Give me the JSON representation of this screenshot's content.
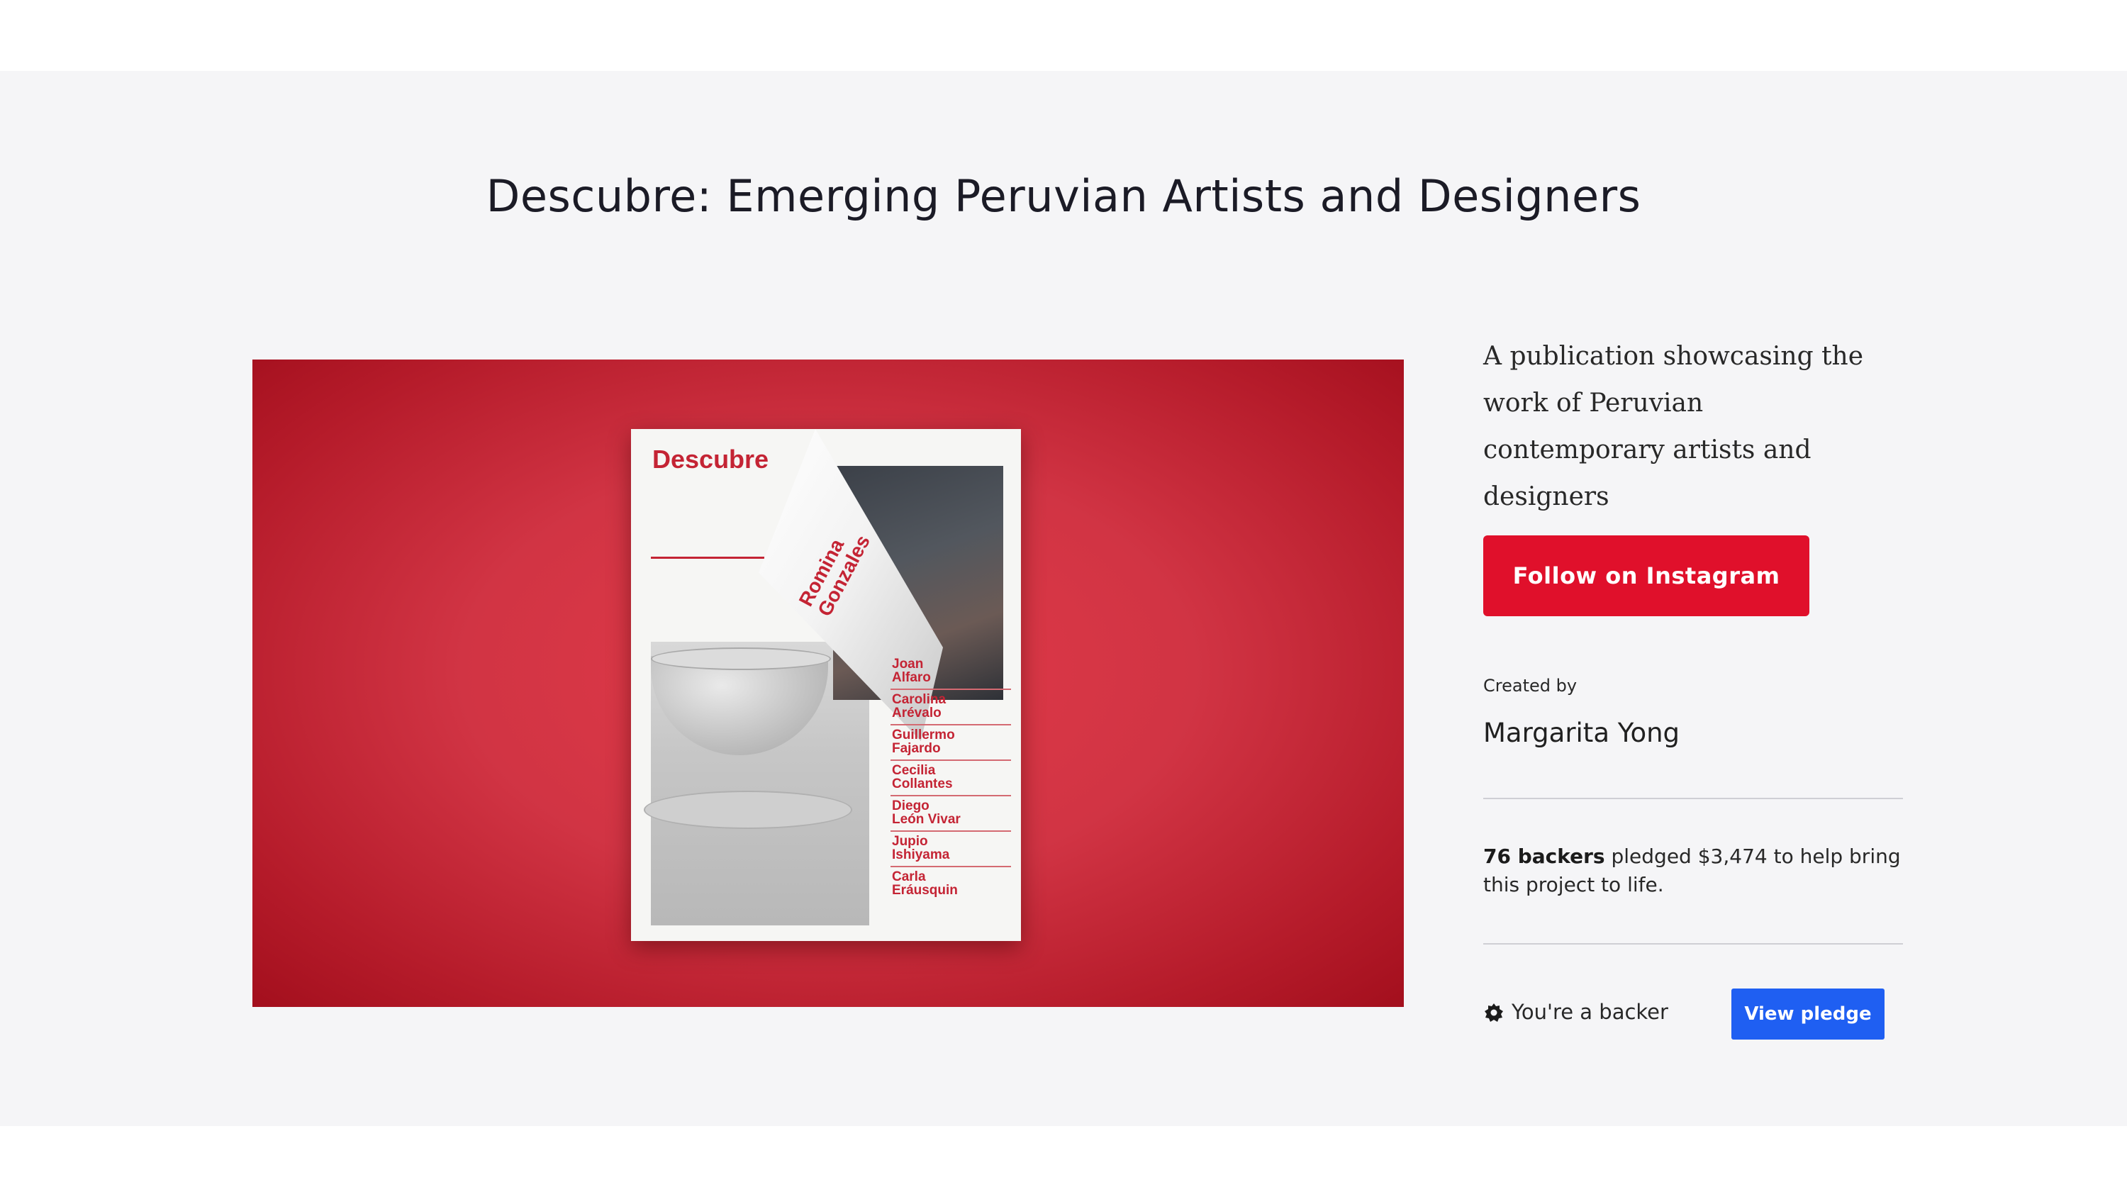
{
  "project": {
    "title": "Descubre: Emerging Peruvian Artists and Designers",
    "description": "A publication showcasing the work of Peruvian contemporary artists and designers",
    "follow_button_label": "Follow on Instagram",
    "created_by_label": "Created by",
    "creator_name": "Margarita Yong",
    "backers_count": "76 backers",
    "backers_text": " pledged $3,474 to help bring this project to life.",
    "backer_status": "You're a backer",
    "view_pledge_label": "View pledge"
  },
  "hero_image": {
    "magazine_title": "Descubre",
    "curl_text": "Romina\nGonzales",
    "names": [
      "Joan\nAlfaro",
      "Carolina\nArévalo",
      "Guillermo\nFajardo",
      "Cecilia\nCollantes",
      "Diego\nLeón Vivar",
      "Jupio\nIshiyama",
      "Carla\nEráusquin"
    ]
  },
  "colors": {
    "accent_red": "#e0102b",
    "pledge_blue": "#1f5ff2",
    "background": "#f5f5f7"
  },
  "icons": {
    "backer": "badge-icon"
  }
}
